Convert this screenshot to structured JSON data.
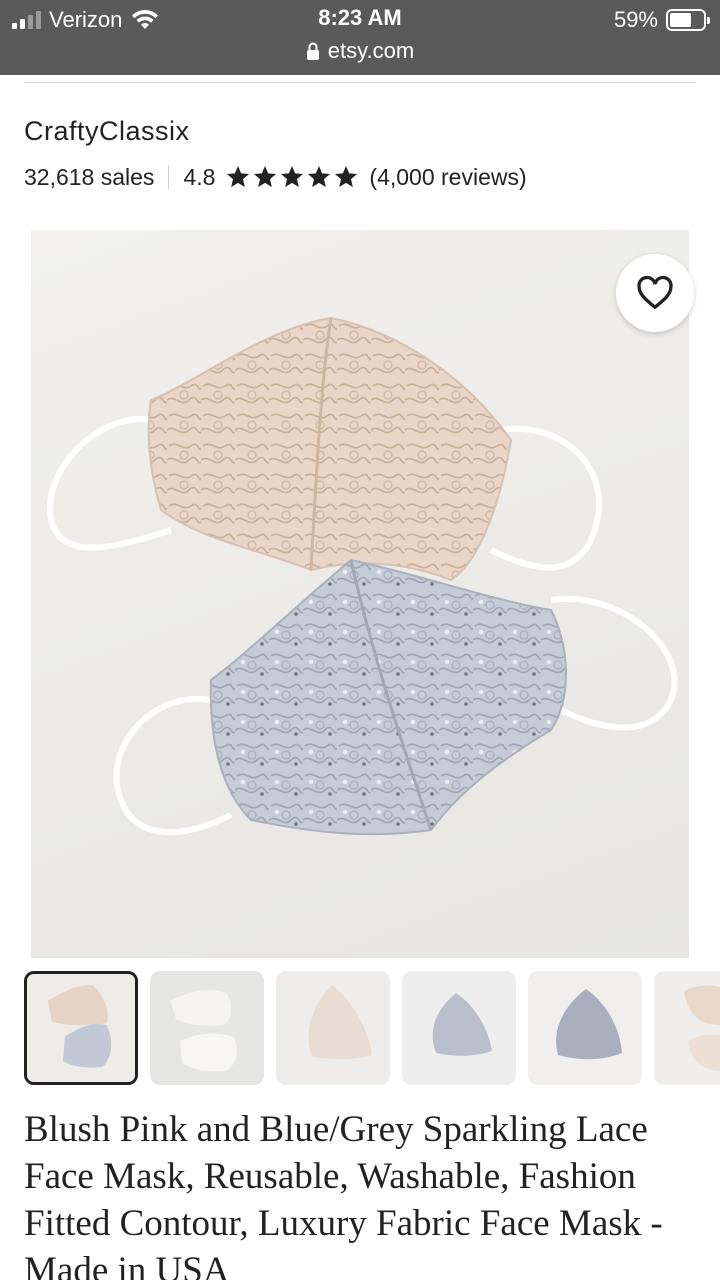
{
  "status_bar": {
    "carrier": "Verizon",
    "time": "8:23 AM",
    "url": "etsy.com",
    "battery_text": "59%",
    "battery_level": 0.59
  },
  "shop": {
    "name": "CraftyClassix",
    "sales": "32,618 sales",
    "rating": "4.8",
    "rating_stars": 5,
    "reviews": "(4,000 reviews)"
  },
  "listing": {
    "title": "Blush Pink and Blue/Grey Sparkling Lace Face Mask, Reusable, Washable, Fashion Fitted Contour, Luxury Fabric Face Mask - Made in USA",
    "selected_thumbnail": 1,
    "thumbnail_count": 6
  },
  "colors": {
    "status_bar_bg": "#5a5a5a",
    "text": "#222222",
    "star": "#222222",
    "blush_mask": "#e8d2c4",
    "grey_mask": "#c3c9d4"
  },
  "icons": {
    "favorite": "heart-outline-icon",
    "star": "star-icon",
    "lock": "lock-icon",
    "wifi": "wifi-icon",
    "signal": "signal-icon",
    "battery": "battery-icon"
  }
}
